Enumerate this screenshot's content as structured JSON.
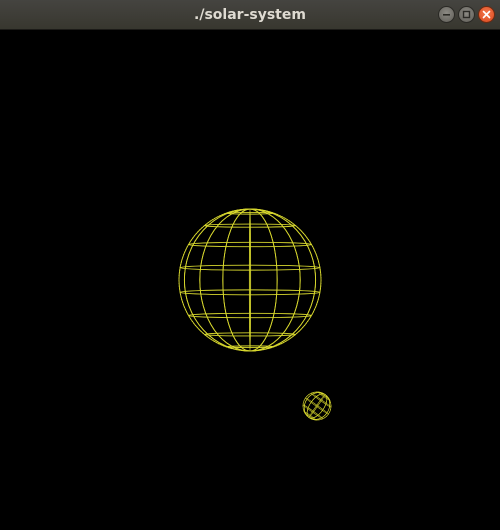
{
  "window": {
    "title": "./solar-system"
  },
  "controls": {
    "minimize_icon": "minimize-icon",
    "maximize_icon": "maximize-icon",
    "close_icon": "close-icon"
  },
  "scene": {
    "background": "#000000",
    "wireframe_color": "#d7d72e",
    "bodies": [
      {
        "name": "sun",
        "kind": "wireframe-sphere"
      },
      {
        "name": "planet",
        "kind": "wireframe-sphere"
      }
    ]
  }
}
